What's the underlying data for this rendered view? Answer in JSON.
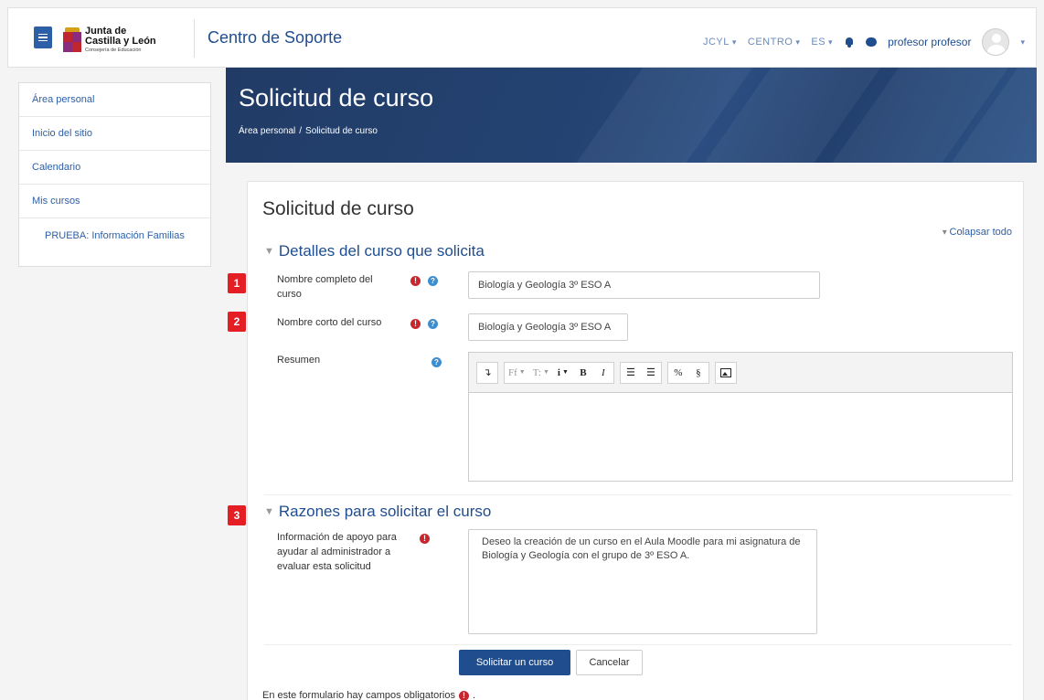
{
  "navbar": {
    "logo": {
      "line1": "Junta de",
      "line2": "Castilla y León",
      "line3": "Consejería de Educación"
    },
    "site_title": "Centro de Soporte",
    "menus": [
      "JCYL",
      "CENTRO",
      "ES"
    ],
    "user_name": "profesor profesor",
    "icons": [
      "menu-icon",
      "bell-icon",
      "chat-icon",
      "avatar"
    ]
  },
  "sidebar": {
    "items": [
      {
        "label": "Área personal"
      },
      {
        "label": "Inicio del sitio"
      },
      {
        "label": "Calendario"
      },
      {
        "label": "Mis cursos"
      },
      {
        "label": "PRUEBA: Información Familias"
      }
    ]
  },
  "header": {
    "title": "Solicitud de curso",
    "breadcrumb": [
      "Área personal",
      "Solicitud de curso"
    ],
    "breadcrumb_sep": "/"
  },
  "form": {
    "title": "Solicitud de curso",
    "collapse_all": "Colapsar todo",
    "section1": "Detalles del curso que solicita",
    "section2": "Razones para solicitar el curso",
    "badges": [
      "1",
      "2",
      "3"
    ],
    "fields": {
      "fullname_label": "Nombre completo del curso",
      "fullname_value": "Biología y Geología 3º ESO A",
      "shortname_label": "Nombre corto del curso",
      "shortname_value": "Biología y Geología 3º ESO A",
      "summary_label": "Resumen",
      "reason_label": "Información de apoyo para ayudar al administrador a evaluar esta solicitud",
      "reason_value": "Deseo la creación de un curso en el Aula Moodle para mi asignatura de Biología y Geología con el grupo de 3º ESO A."
    },
    "toolbar": {
      "expand": "↴",
      "font_family": "Ff",
      "font_size": "T:",
      "info": "i",
      "bold": "B",
      "italic": "I",
      "unordered_list": "☰",
      "ordered_list": "☰",
      "link": "%",
      "unlink": "§",
      "image": "image-icon"
    },
    "submit": "Solicitar un curso",
    "cancel": "Cancelar",
    "required_note": "En este formulario hay campos obligatorios",
    "required_note_end": "."
  },
  "colors": {
    "primary": "#1f4d8e",
    "badge": "#e31e25",
    "required": "#c9252c",
    "help": "#3e8ecf"
  }
}
